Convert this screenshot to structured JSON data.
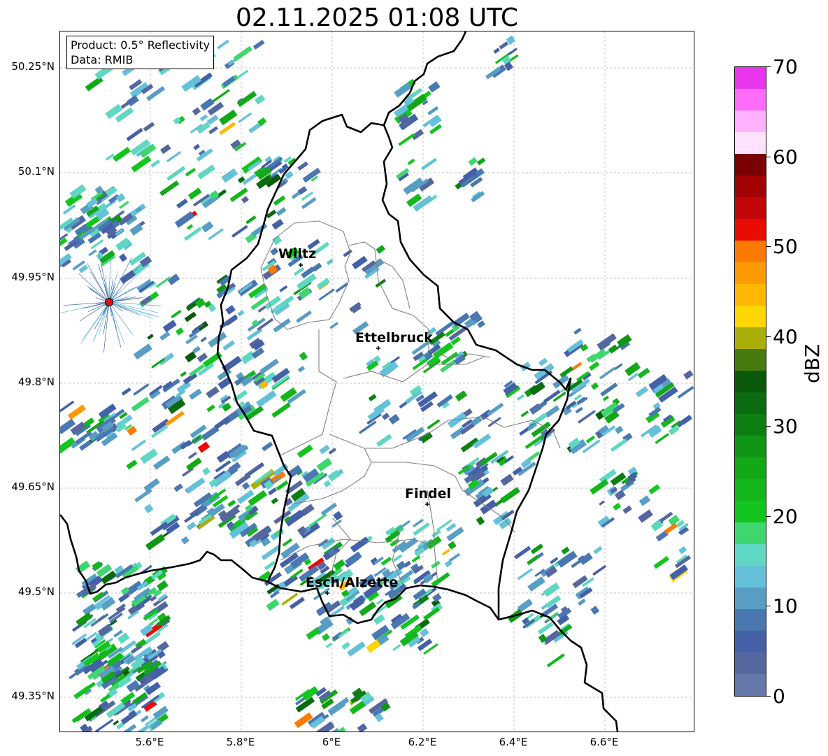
{
  "title": "02.11.2025 01:08 UTC",
  "info": {
    "product": "Product: 0.5° Reflectivity",
    "data": "Data: RMIB"
  },
  "axes": {
    "y_labels": [
      "50.25°N",
      "50.1°N",
      "49.95°N",
      "49.8°N",
      "49.65°N",
      "49.5°N",
      "49.35°N"
    ],
    "x_labels": [
      "5.6°E",
      "5.8°E",
      "6°E",
      "6.2°E",
      "6.4°E",
      "6.6°E"
    ]
  },
  "cities": [
    {
      "name": "Wiltz"
    },
    {
      "name": "Ettelbruck"
    },
    {
      "name": "Findel"
    },
    {
      "name": "Esch/Alzette"
    }
  ],
  "colorbar": {
    "label": "dBZ",
    "ticks": [
      "0",
      "10",
      "20",
      "30",
      "40",
      "50",
      "60",
      "70"
    ],
    "colors": [
      "#6677aa",
      "#55679f",
      "#4460a6",
      "#4a77b0",
      "#579dc4",
      "#65c1d9",
      "#5fd7c2",
      "#3ed66e",
      "#13c51f",
      "#13b71b",
      "#12a817",
      "#0f9614",
      "#0d7f12",
      "#0a6b10",
      "#0b5a0c",
      "#477a0f",
      "#a9af08",
      "#fdd603",
      "#fcb803",
      "#fc9903",
      "#fc7a02",
      "#e90b04",
      "#c20506",
      "#a20204",
      "#7a0003",
      "#ffe2fb",
      "#ffb3ff",
      "#ff6cf9",
      "#e935ed"
    ]
  },
  "colors": {
    "border": "#000000",
    "district": "#808080",
    "radar_site": "#e01010"
  }
}
